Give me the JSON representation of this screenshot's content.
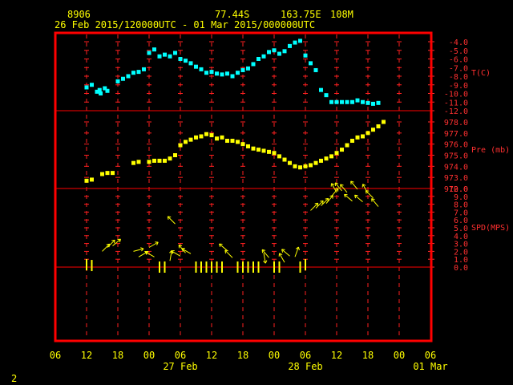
{
  "header": {
    "station": "8906",
    "lat": "77.44S",
    "lon": "163.75E",
    "elev": "108M",
    "range": "26 Feb 2015/120000UTC - 01 Mar 2015/000000UTC"
  },
  "footer": {
    "page": "2"
  },
  "colors": {
    "frame": "#ff0000",
    "tick": "#ff2020",
    "text": "#ffff00",
    "temp": "#00ffff",
    "pres": "#ffff00",
    "wind": "#ffff00",
    "right_axis": "#ff3030"
  },
  "chart_data": [
    {
      "type": "scatter",
      "name": "T(C)",
      "ylabel": "T(C)",
      "ylim": [
        -12.0,
        -4.0
      ],
      "ticks": [
        "-4.0",
        "-5.0",
        "-6.0",
        "-7.0",
        "-8.0",
        "-9.0",
        "-10.0",
        "-11.0",
        "-12.0"
      ],
      "x_hours": [
        12,
        13,
        14,
        14.5,
        14.7,
        15.5,
        16,
        18,
        19,
        20,
        21,
        22,
        23,
        24,
        25,
        26,
        27,
        28,
        29,
        30,
        31,
        32,
        33,
        34,
        35,
        36,
        37,
        38,
        39,
        40,
        41,
        42,
        43,
        44,
        45,
        46,
        47,
        48,
        49,
        50,
        51,
        52,
        53,
        54,
        55,
        56,
        57,
        58,
        59,
        60,
        61,
        62,
        63,
        64,
        65,
        66,
        67,
        68
      ],
      "values": [
        -9.3,
        -9.0,
        -9.8,
        -9.6,
        -10.0,
        -9.4,
        -9.7,
        -8.6,
        -8.3,
        -8.0,
        -7.6,
        -7.5,
        -7.2,
        -5.3,
        -4.9,
        -5.7,
        -5.5,
        -5.7,
        -5.3,
        -6.0,
        -6.2,
        -6.5,
        -6.9,
        -7.2,
        -7.6,
        -7.5,
        -7.7,
        -7.8,
        -7.7,
        -8.0,
        -7.6,
        -7.3,
        -7.1,
        -6.6,
        -6.0,
        -5.7,
        -5.2,
        -5.0,
        -5.4,
        -5.1,
        -4.5,
        -4.1,
        -3.9,
        -5.6,
        -6.5,
        -7.3,
        -9.6,
        -10.2,
        -11.0,
        -11.0,
        -11.0,
        -11.0,
        -11.0,
        -10.8,
        -11.0,
        -11.1,
        -11.2,
        -11.1
      ]
    },
    {
      "type": "scatter",
      "name": "Pre (mb)",
      "ylabel": "Pre (mb)",
      "ylim": [
        972.0,
        978.0
      ],
      "ticks": [
        "978.0",
        "977.0",
        "976.0",
        "975.0",
        "974.0",
        "973.0",
        "972.0"
      ],
      "x_hours": [
        12,
        13,
        15,
        16,
        17,
        21,
        22,
        24,
        25,
        26,
        27,
        28,
        29,
        30,
        31,
        32,
        33,
        34,
        35,
        36,
        37,
        38,
        39,
        40,
        41,
        42,
        43,
        44,
        45,
        46,
        47,
        48,
        49,
        50,
        51,
        52,
        53,
        54,
        55,
        56,
        57,
        58,
        59,
        60,
        61,
        62,
        63,
        64,
        65,
        66,
        67,
        68,
        69
      ],
      "values": [
        972.7,
        972.8,
        973.3,
        973.4,
        973.4,
        974.3,
        974.4,
        974.4,
        974.5,
        974.5,
        974.5,
        974.7,
        975.0,
        975.9,
        976.2,
        976.4,
        976.6,
        976.7,
        976.9,
        976.8,
        976.5,
        976.6,
        976.3,
        976.3,
        976.2,
        976.0,
        975.8,
        975.6,
        975.5,
        975.4,
        975.3,
        975.2,
        974.9,
        974.6,
        974.3,
        974.0,
        973.9,
        974.0,
        974.1,
        974.3,
        974.5,
        974.7,
        974.9,
        975.2,
        975.5,
        975.9,
        976.3,
        976.6,
        976.7,
        977.0,
        977.3,
        977.6,
        978.0
      ]
    },
    {
      "type": "scatter",
      "name": "SPD(MPS)",
      "ylabel": "SPD(MPS)",
      "ylim": [
        0.0,
        10.0
      ],
      "ticks": [
        "10.0",
        "9.0",
        "8.0",
        "7.0",
        "6.0",
        "5.0",
        "4.0",
        "3.0",
        "2.0",
        "1.0",
        "0.0"
      ],
      "x_hours": [
        12,
        13,
        15,
        16,
        17,
        21,
        22,
        24,
        25,
        26,
        27,
        28,
        29,
        30,
        31,
        32,
        33,
        34,
        35,
        36,
        37,
        38,
        39,
        40,
        41,
        42,
        43,
        44,
        45,
        46,
        47,
        48,
        49,
        50,
        51,
        52,
        53,
        54,
        55,
        56,
        57,
        58,
        59,
        60,
        61,
        62,
        63,
        64,
        65,
        66,
        67,
        68
      ],
      "values": [
        0.3,
        0.2,
        2.0,
        2.5,
        2.7,
        2.0,
        1.3,
        2.5,
        1.3,
        0.0,
        0.0,
        0.8,
        5.5,
        1.4,
        1.8,
        1.7,
        0.0,
        0.0,
        0.0,
        0.0,
        0.0,
        0.0,
        2.1,
        1.2,
        0.0,
        0.0,
        0.0,
        0.0,
        0.0,
        1.8,
        1.2,
        0.0,
        0.0,
        0.6,
        1.4,
        1.3,
        0.0,
        0.3,
        7.2,
        7.5,
        7.8,
        8.1,
        9.0,
        9.5,
        9.7,
        9.5,
        8.4,
        9.9,
        8.3,
        9.4,
        8.8,
        7.7
      ],
      "directions_deg": [
        70,
        80,
        45,
        45,
        50,
        75,
        60,
        60,
        300,
        0,
        0,
        10,
        315,
        300,
        320,
        300,
        0,
        0,
        0,
        0,
        0,
        0,
        310,
        315,
        0,
        0,
        0,
        0,
        0,
        170,
        320,
        0,
        0,
        330,
        310,
        20,
        0,
        0,
        45,
        45,
        45,
        40,
        40,
        330,
        320,
        320,
        310,
        320,
        310,
        330,
        315,
        320
      ]
    }
  ],
  "x_axis": {
    "ticks": [
      "06",
      "12",
      "18",
      "00",
      "06",
      "12",
      "18",
      "00",
      "06",
      "12",
      "18",
      "00",
      "06"
    ],
    "tick_hours": [
      6,
      12,
      18,
      24,
      30,
      36,
      42,
      48,
      54,
      60,
      66,
      72,
      78
    ],
    "day_labels": [
      {
        "hour": 30,
        "label": "27 Feb"
      },
      {
        "hour": 54,
        "label": "28 Feb"
      },
      {
        "hour": 78,
        "label": "01 Mar"
      }
    ]
  }
}
